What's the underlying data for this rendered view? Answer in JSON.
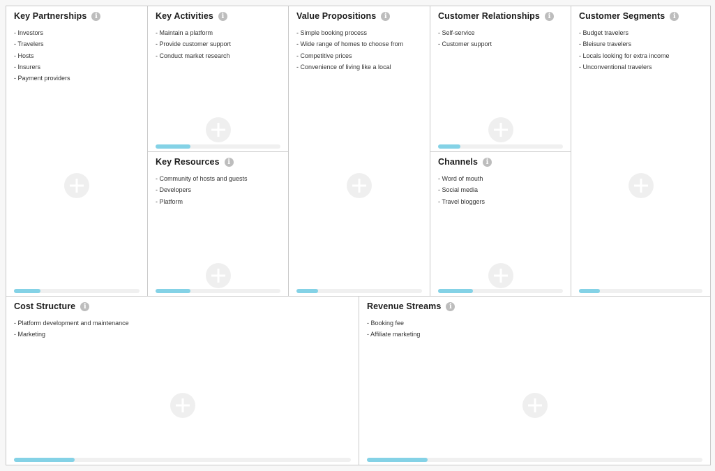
{
  "canvas": {
    "accent_color": "#84d2e6",
    "blocks": {
      "key_partnerships": {
        "title": "Key Partnerships",
        "items": [
          "- Investors",
          "- Travelers",
          "- Hosts",
          "- Insurers",
          "- Payment providers"
        ],
        "progress": 0.21
      },
      "key_activities": {
        "title": "Key Activities",
        "items": [
          "- Maintain a platform",
          "- Provide customer support",
          "- Conduct market research"
        ],
        "progress": 0.28
      },
      "key_resources": {
        "title": "Key Resources",
        "items": [
          "- Community of hosts and guests",
          "- Developers",
          "- Platform"
        ],
        "progress": 0.28
      },
      "value_propositions": {
        "title": "Value Propositions",
        "items": [
          "- Simple booking process",
          "- Wide range of homes to choose from",
          "- Competitive prices",
          "- Convenience of living like a local"
        ],
        "progress": 0.17
      },
      "customer_relationships": {
        "title": "Customer Relationships",
        "items": [
          "- Self-service",
          "- Customer support"
        ],
        "progress": 0.18
      },
      "channels": {
        "title": "Channels",
        "items": [
          "- Word of mouth",
          "- Social media",
          "- Travel bloggers"
        ],
        "progress": 0.28
      },
      "customer_segments": {
        "title": "Customer Segments",
        "items": [
          "- Budget travelers",
          "- Bleisure travelers",
          "- Locals looking for extra income",
          "- Unconventional travelers"
        ],
        "progress": 0.17
      },
      "cost_structure": {
        "title": "Cost Structure",
        "items": [
          "- Platform development and maintenance",
          "- Marketing"
        ],
        "progress": 0.18
      },
      "revenue_streams": {
        "title": "Revenue Streams",
        "items": [
          "- Booking fee",
          "- Affiliate marketing"
        ],
        "progress": 0.18
      }
    },
    "icons": {
      "info": "info-icon",
      "add": "plus-circle-icon"
    }
  }
}
